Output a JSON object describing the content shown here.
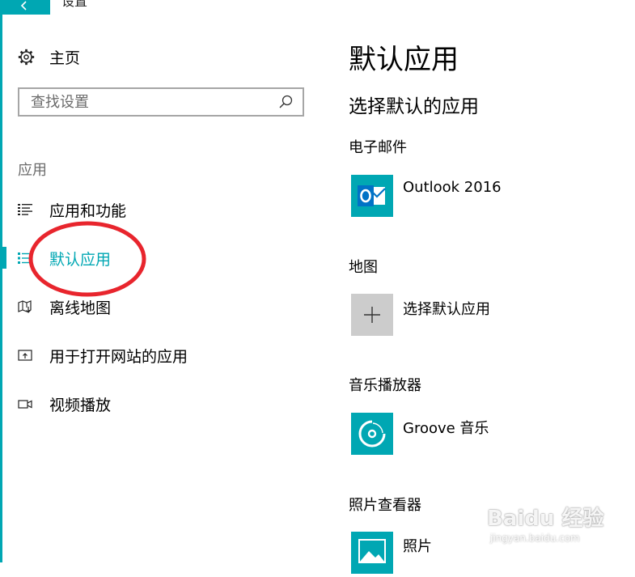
{
  "window": {
    "title": "设置",
    "accent_color": "#00a7b3",
    "back_icon": "back-arrow-icon"
  },
  "sidebar": {
    "home": {
      "label": "主页",
      "icon": "gear-icon"
    },
    "search": {
      "placeholder": "查找设置",
      "icon": "search-icon"
    },
    "section_label": "应用",
    "items": [
      {
        "label": "应用和功能",
        "icon": "list-icon",
        "selected": false
      },
      {
        "label": "默认应用",
        "icon": "default-apps-icon",
        "selected": true
      },
      {
        "label": "离线地图",
        "icon": "map-download-icon",
        "selected": false
      },
      {
        "label": "用于打开网站的应用",
        "icon": "open-website-icon",
        "selected": false
      },
      {
        "label": "视频播放",
        "icon": "video-icon",
        "selected": false
      }
    ]
  },
  "annotation": {
    "shape": "ellipse",
    "color": "#e8252d",
    "target": "默认应用"
  },
  "main": {
    "title": "默认应用",
    "subtitle": "选择默认的应用",
    "categories": [
      {
        "label": "电子邮件",
        "app": "Outlook 2016",
        "icon": "outlook-icon",
        "tile_color": "#00a7b3"
      },
      {
        "label": "地图",
        "app": "选择默认应用",
        "icon": "plus-icon",
        "tile_color": "#cccccc"
      },
      {
        "label": "音乐播放器",
        "app": "Groove 音乐",
        "icon": "groove-music-icon",
        "tile_color": "#00a7b3"
      },
      {
        "label": "照片查看器",
        "app": "照片",
        "icon": "photos-icon",
        "tile_color": "#00a7b3"
      }
    ]
  },
  "watermark": {
    "brand": "Baidu 经验",
    "url": "jingyan.baidu.com"
  }
}
